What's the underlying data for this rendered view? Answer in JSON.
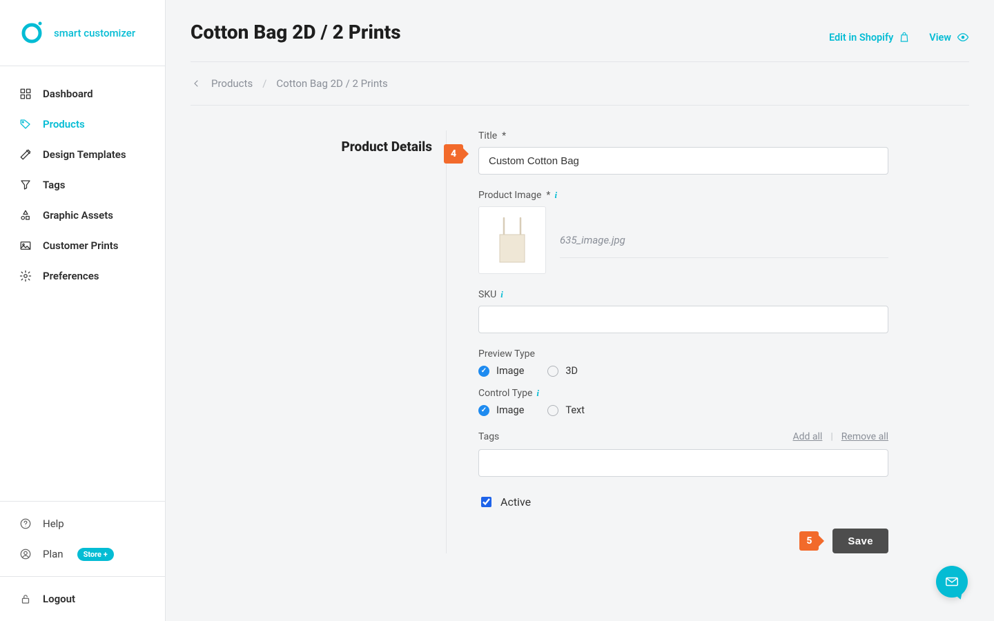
{
  "brand": {
    "name": "smart customizer"
  },
  "nav": {
    "items": [
      {
        "label": "Dashboard",
        "active": false
      },
      {
        "label": "Products",
        "active": true
      },
      {
        "label": "Design Templates",
        "active": false
      },
      {
        "label": "Tags",
        "active": false
      },
      {
        "label": "Graphic Assets",
        "active": false
      },
      {
        "label": "Customer Prints",
        "active": false
      },
      {
        "label": "Preferences",
        "active": false
      }
    ],
    "help": "Help",
    "plan": "Plan",
    "plan_badge": "Store +",
    "logout": "Logout"
  },
  "header": {
    "title": "Cotton Bag 2D / 2 Prints",
    "edit_link": "Edit in Shopify",
    "view_link": "View"
  },
  "breadcrumb": {
    "parent": "Products",
    "current": "Cotton Bag 2D / 2 Prints"
  },
  "section": {
    "title": "Product Details"
  },
  "form": {
    "title_label": "Title",
    "title_value": "Custom Cotton Bag",
    "image_label": "Product Image",
    "image_filename": "635_image.jpg",
    "sku_label": "SKU",
    "sku_value": "",
    "preview_label": "Preview Type",
    "preview_options": {
      "a": "Image",
      "b": "3D"
    },
    "control_label": "Control Type",
    "control_options": {
      "a": "Image",
      "b": "Text"
    },
    "tags_label": "Tags",
    "add_all": "Add all",
    "remove_all": "Remove all",
    "active_label": "Active",
    "save": "Save"
  },
  "callouts": {
    "four": "4",
    "five": "5"
  }
}
